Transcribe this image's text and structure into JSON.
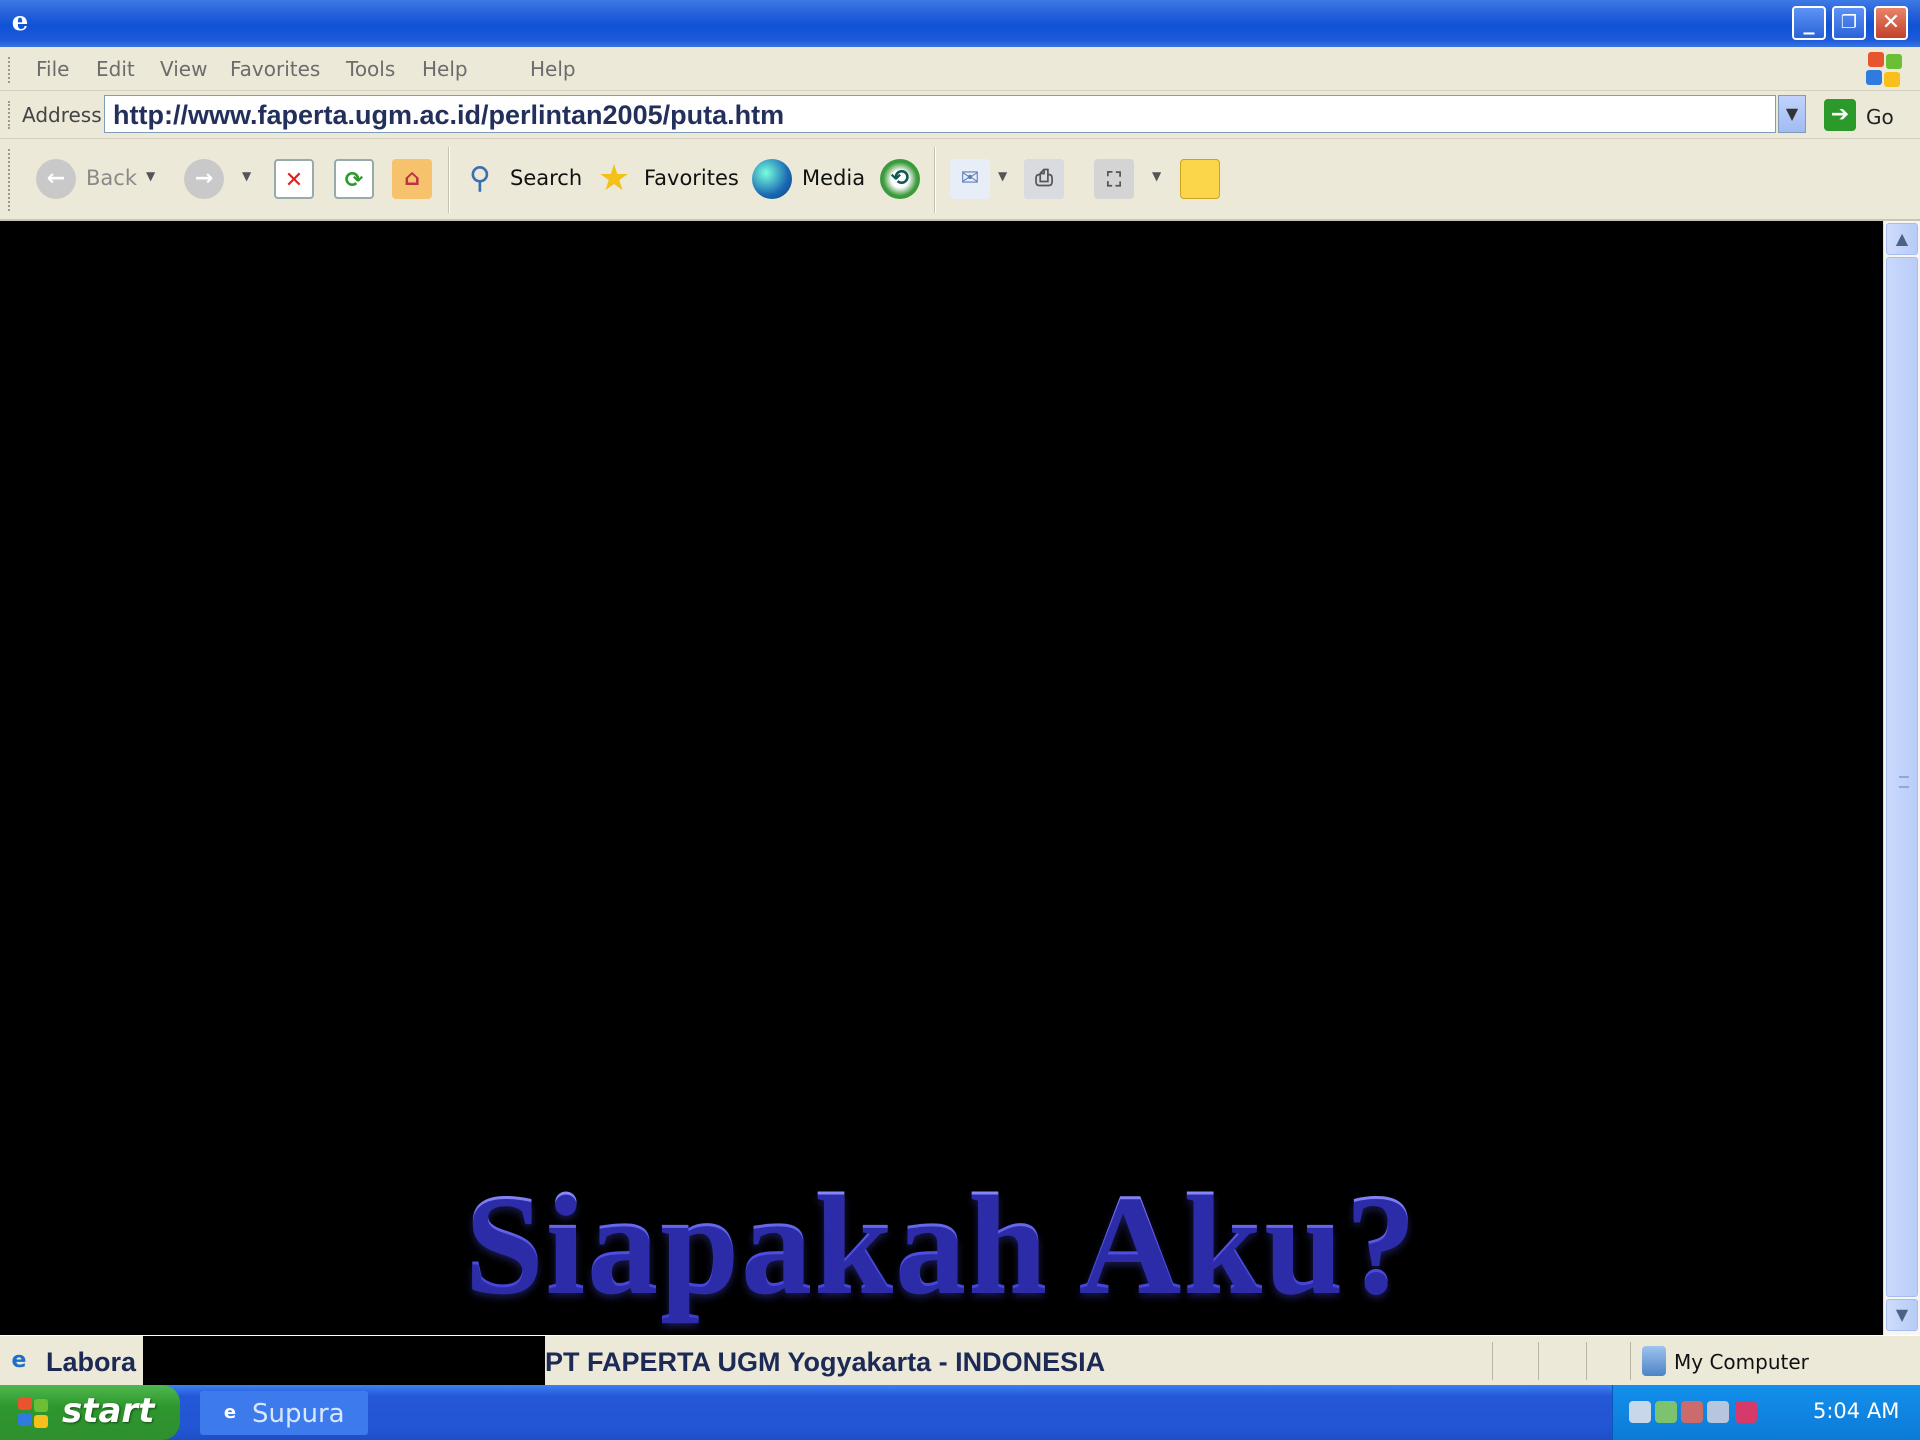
{
  "window": {
    "controls": {
      "minimize_icon": "minimize-icon",
      "restore_icon": "restore-icon",
      "close_icon": "close-icon"
    }
  },
  "menu": [
    "File",
    "Edit",
    "View",
    "Favorites",
    "Tools",
    "Help",
    "Help"
  ],
  "address": {
    "label": "Address",
    "url": "http://www.faperta.ugm.ac.id/perlintan2005/puta.htm",
    "go_label": "Go"
  },
  "toolbar": {
    "back_label": "Back",
    "search_label": "Search",
    "favorites_label": "Favorites",
    "media_label": "Media"
  },
  "content": {
    "headline": "Siapakah Aku?"
  },
  "status": {
    "text": "PT FAPERTA UGM Yogyakarta - INDONESIA",
    "zone_label": "My Computer"
  },
  "taskbar": {
    "start_label": "start",
    "task_label": "Supura",
    "clock": "5:04 AM"
  },
  "colors": {
    "titlebar": "#0f52d6",
    "headline": "#5a5ae8",
    "taskbar": "#2255d3",
    "start": "#2d972d"
  }
}
